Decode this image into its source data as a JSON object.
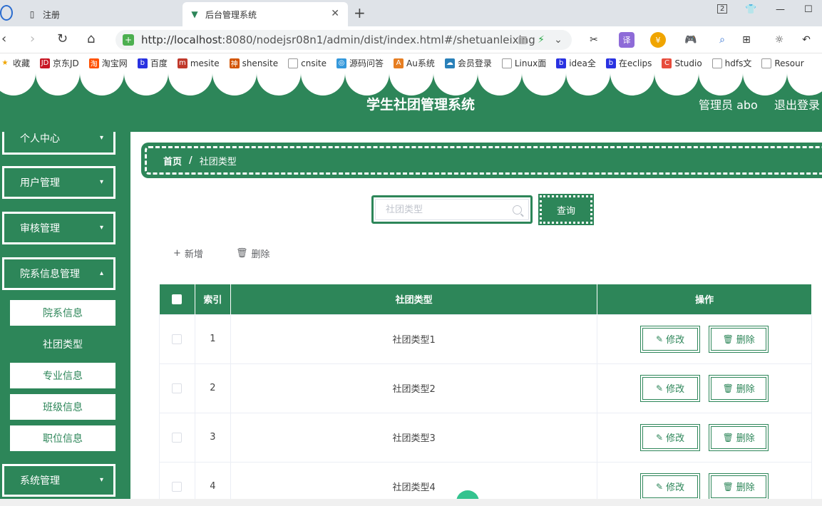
{
  "browser": {
    "tabs": [
      {
        "title": "注册",
        "active": false
      },
      {
        "title": "后台管理系统",
        "active": true
      }
    ],
    "tab_count_badge": "2",
    "url_host": "http://localhost",
    "url_rest": ":8080/nodejsr08n1/admin/dist/index.html#/shetuanleixing",
    "translate_label": "译",
    "bookmarks": [
      "收藏",
      "京东JD",
      "淘宝网",
      "百度",
      "mesite",
      "shensite",
      "cnsite",
      "源码问答",
      "Au系统",
      "会员登录",
      "Linux面",
      "idea全",
      "在eclips",
      "Studio",
      "hdfs文",
      "Resour"
    ]
  },
  "header": {
    "title": "学生社团管理系统",
    "user": "管理员 abo",
    "logout": "退出登录"
  },
  "sidebar": {
    "menus": [
      {
        "label": "个人中心"
      },
      {
        "label": "用户管理"
      },
      {
        "label": "审核管理"
      },
      {
        "label": "院系信息管理"
      }
    ],
    "sub_items": [
      {
        "label": "院系信息",
        "active": false
      },
      {
        "label": "社团类型",
        "active": true
      },
      {
        "label": "专业信息",
        "active": false
      },
      {
        "label": "班级信息",
        "active": false
      },
      {
        "label": "职位信息",
        "active": false
      }
    ],
    "last_menu": {
      "label": "系统管理"
    }
  },
  "breadcrumb": {
    "home": "首页",
    "separator": "/",
    "current": "社团类型"
  },
  "search": {
    "placeholder": "社团类型",
    "value": "",
    "button": "查询"
  },
  "actions": {
    "add": "新增",
    "delete": "删除"
  },
  "table": {
    "headers": [
      "索引",
      "社团类型",
      "操作"
    ],
    "rows": [
      {
        "index": "1",
        "type": "社团类型1"
      },
      {
        "index": "2",
        "type": "社团类型2"
      },
      {
        "index": "3",
        "type": "社团类型3"
      },
      {
        "index": "4",
        "type": "社团类型4"
      }
    ],
    "edit_label": "修改",
    "delete_label": "删除"
  },
  "colors": {
    "primary": "#2d8659",
    "white": "#ffffff"
  }
}
